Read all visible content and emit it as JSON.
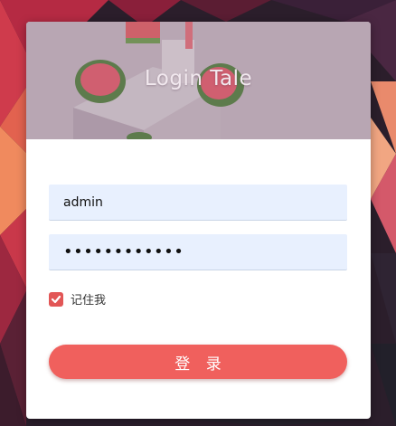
{
  "banner": {
    "title": "Login Tale"
  },
  "form": {
    "username_value": "admin",
    "password_value": "••••••••••••",
    "remember_label": "记住我",
    "remember_checked": true,
    "login_label": "登 录"
  },
  "colors": {
    "accent": "#f0605d",
    "checkbox": "#e25656",
    "input_bg": "#e8f0fe",
    "banner_tint": "#b6a3b0"
  }
}
